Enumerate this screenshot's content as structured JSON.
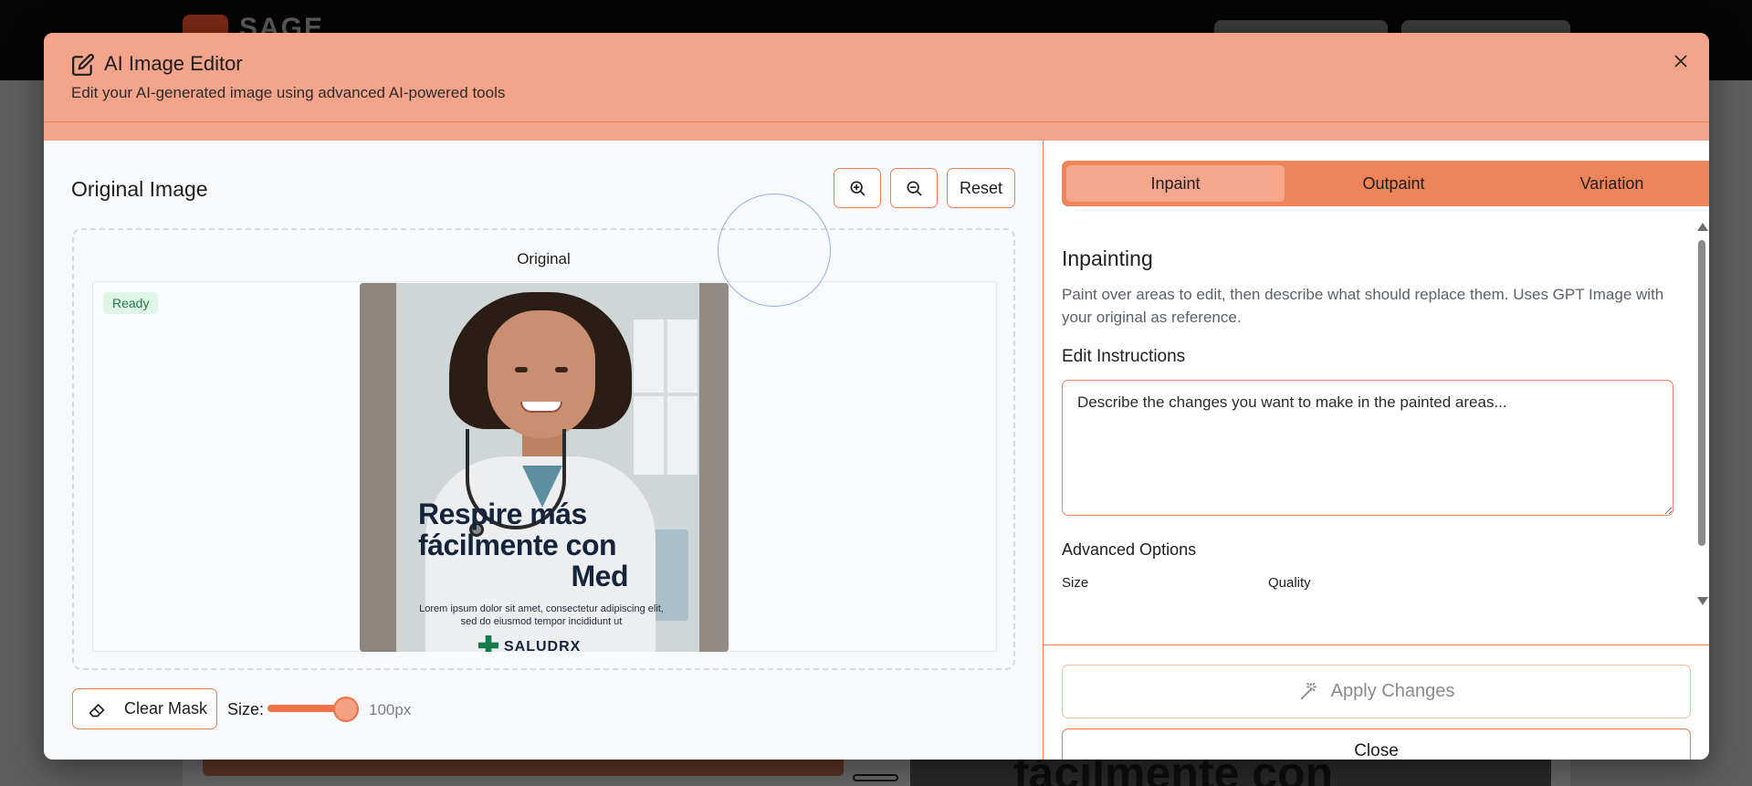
{
  "background": {
    "logo_text": "SAGE",
    "poster_text": "fácilmente con"
  },
  "modal": {
    "title": "AI Image Editor",
    "subtitle": "Edit your AI-generated image using advanced AI-powered tools",
    "close_icon": "close-icon",
    "accent_color": "#ee8457"
  },
  "left": {
    "title": "Original Image",
    "zoom_in_icon": "zoom-in-icon",
    "zoom_out_icon": "zoom-out-icon",
    "reset_label": "Reset",
    "canvas_label": "Original",
    "status_badge": "Ready",
    "status_color": "#1f7a43",
    "poster": {
      "headline_1": "Respire más",
      "headline_2": "fácilmente con",
      "headline_3": "Med",
      "body": "Lorem ipsum dolor sit amet, consectetur adipiscing elit, sed do eiusmod tempor incididunt ut",
      "brand": "SALUDRX"
    },
    "clear_mask_label": "Clear Mask",
    "size_label": "Size:",
    "brush_size": "100px",
    "brush_size_fraction": 1.0
  },
  "right": {
    "tabs": [
      {
        "label": "Inpaint",
        "active": true
      },
      {
        "label": "Outpaint",
        "active": false
      },
      {
        "label": "Variation",
        "active": false
      }
    ],
    "section_title": "Inpainting",
    "section_desc": "Paint over areas to edit, then describe what should replace them. Uses GPT Image with your original as reference.",
    "edit_label": "Edit Instructions",
    "edit_placeholder": "Describe the changes you want to make in the painted areas...",
    "advanced_title": "Advanced Options",
    "option_size_label": "Size",
    "option_quality_label": "Quality",
    "apply_label": "Apply Changes",
    "apply_icon": "magic-wand-icon",
    "close_label": "Close"
  }
}
